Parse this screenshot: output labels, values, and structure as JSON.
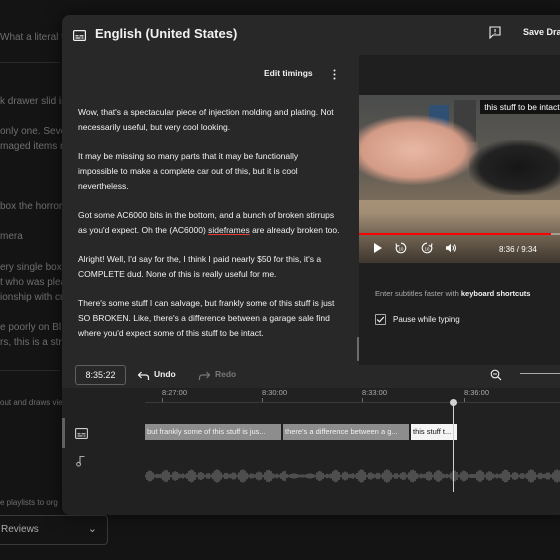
{
  "background": {
    "lines": [
      {
        "text": "What a literal t"
      },
      {
        "text": "k drawer slid in"
      },
      {
        "text": "only one. Sever"
      },
      {
        "text": "maged items m"
      },
      {
        "text": "box the horror!"
      },
      {
        "text": "mera"
      },
      {
        "text": "ery single box "
      },
      {
        "text": "t who was plea"
      },
      {
        "text": "ionship with cu"
      },
      {
        "text": "e poorly on Bl"
      },
      {
        "text": "rs, this is a stri"
      },
      {
        "text": "out and draws vie"
      },
      {
        "text": "e playlists to org"
      }
    ],
    "select_label": "Reviews"
  },
  "dialog": {
    "title": "English (United States)",
    "save_draft": "Save Draft"
  },
  "editor": {
    "edit_timings": "Edit timings",
    "paragraphs": [
      {
        "text": "Wow, that's a spectacular piece of injection molding and plating. Not necessarily useful, but very cool looking."
      },
      {
        "text": "It may be missing so many parts that it may be functionally impossible to make a complete car out of this, but it is cool nevertheless."
      },
      {
        "pre": "Got some AC6000 bits in the bottom, and a bunch of broken stirrups as you'd expect. Oh the (AC6000) ",
        "ul": "sideframes",
        "post": " are already broken too."
      },
      {
        "text": "Alright! Well, I'd say for the, I think I paid nearly $50 for this, it's a COMPLETE dud. None of this is really useful for me."
      },
      {
        "text": "There's some stuff I can salvage, but frankly some of this stuff is just SO BROKEN. Like, there's a difference between a garage sale find where you'd expect some of this stuff to be intact."
      }
    ]
  },
  "player": {
    "caption": "this stuff to be intact.",
    "time": "8:36 / 9:34",
    "progress": 0.9,
    "progress_color": "#ff0000",
    "shortcut_hint_pre": "Enter subtitles faster with ",
    "shortcut_hint_bold": "keyboard shortcuts",
    "pause_label": "Pause while typing",
    "pause_checked": true
  },
  "toolbar": {
    "timecode": "8:35:22",
    "undo": "Undo",
    "redo": "Redo"
  },
  "timeline": {
    "ticks": [
      {
        "label": "8:27:00"
      },
      {
        "label": "8:30:00"
      },
      {
        "label": "8:33:00"
      },
      {
        "label": "8:36:00"
      }
    ],
    "blocks": [
      {
        "text": "but frankly  some of this stuff is jus...",
        "style": "gray"
      },
      {
        "text": "there's a difference between a g...",
        "style": "gray"
      },
      {
        "text": "this stuff t...",
        "style": "white"
      }
    ]
  }
}
